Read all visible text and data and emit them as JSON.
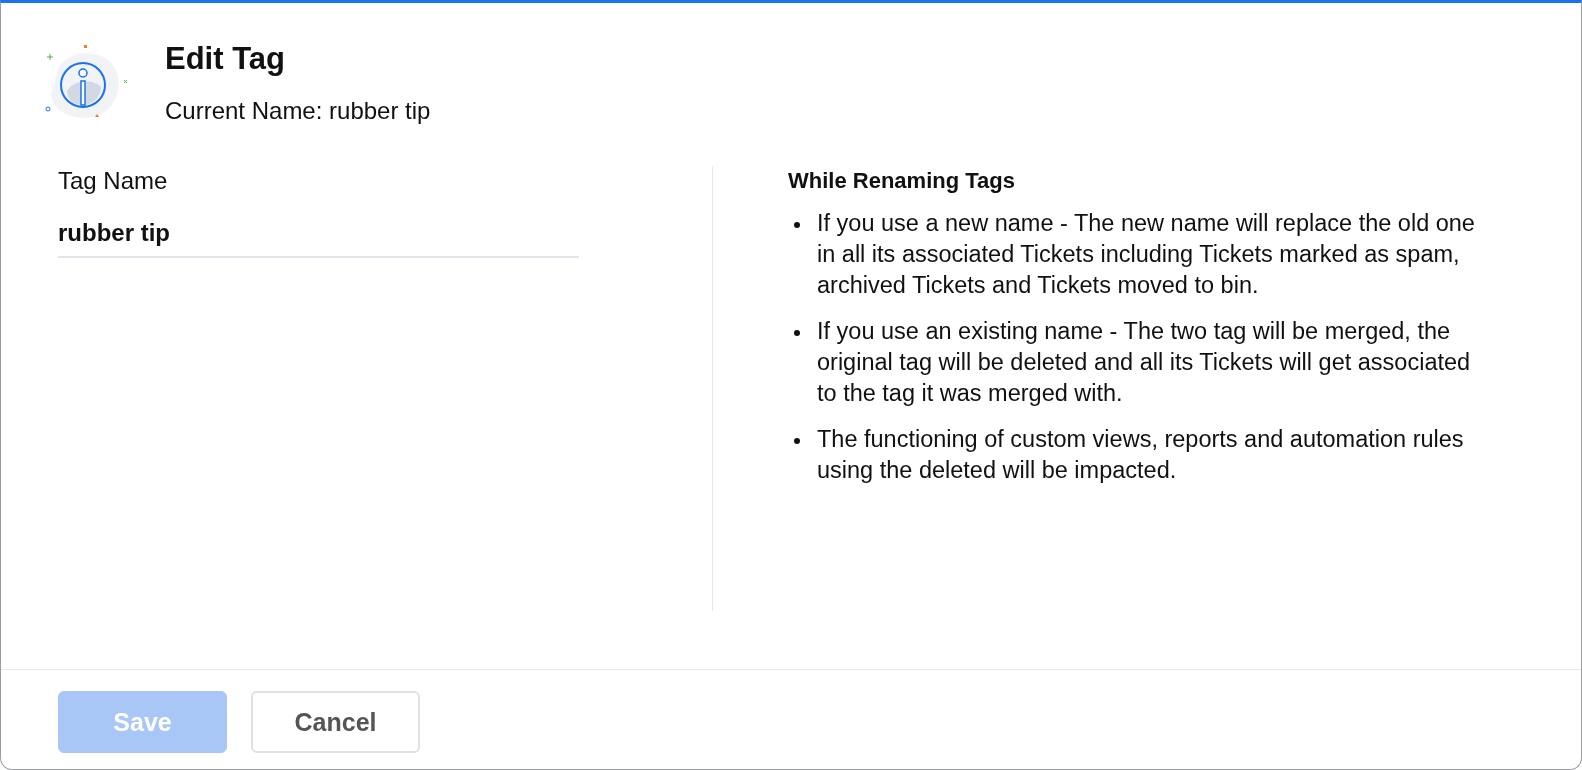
{
  "dialog": {
    "title": "Edit Tag",
    "subtitle": "Current Name: rubber tip"
  },
  "field": {
    "label": "Tag Name",
    "value": "rubber tip"
  },
  "info": {
    "heading": "While Renaming Tags",
    "items": [
      "If you use a new name - The new name will replace the old one in all its associated Tickets including Tickets marked as spam, archived Tickets and Tickets moved to bin.",
      "If you use an existing name - The two tag will be merged, the original tag will be deleted and all its Tickets will get associated to the tag it was merged with.",
      "The functioning of custom views, reports and automation rules using the deleted will be impacted."
    ]
  },
  "buttons": [
    {
      "label": "Save",
      "kind": "primary",
      "disabled": true
    },
    {
      "label": "Cancel",
      "kind": "secondary",
      "disabled": false
    }
  ]
}
